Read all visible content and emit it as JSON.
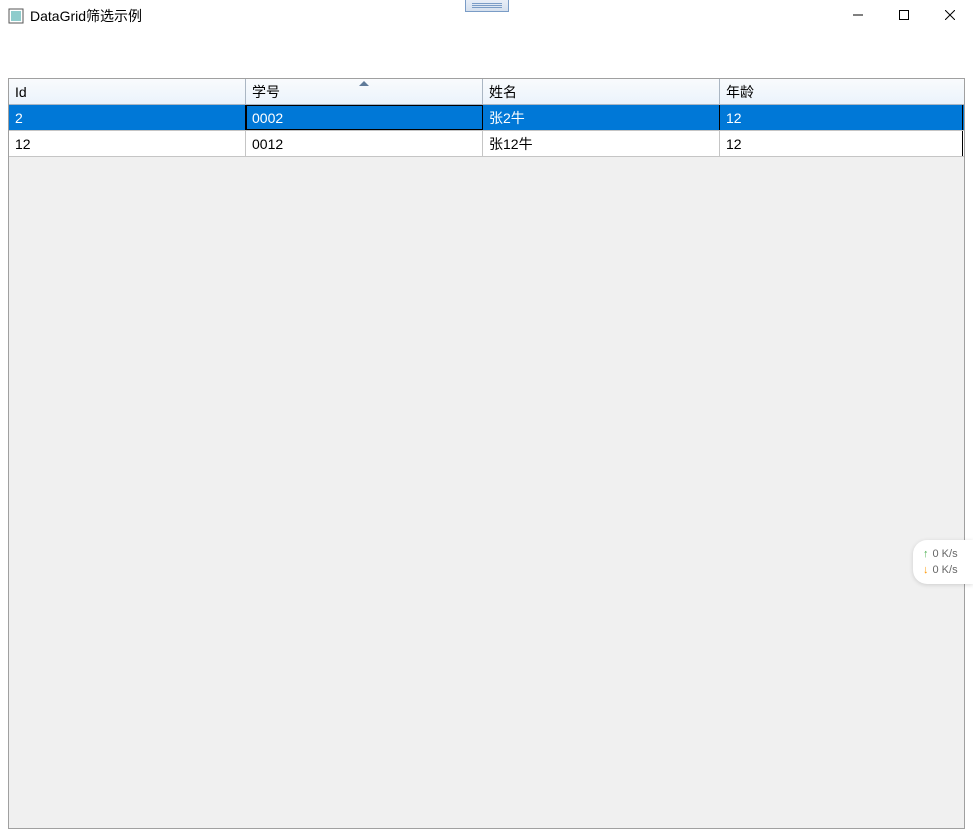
{
  "window": {
    "title": "DataGrid筛选示例"
  },
  "grid": {
    "columns": [
      {
        "header": "Id",
        "sorted": false
      },
      {
        "header": "学号",
        "sorted": true
      },
      {
        "header": "姓名",
        "sorted": false
      },
      {
        "header": "年龄",
        "sorted": false
      }
    ],
    "rows": [
      {
        "selected": true,
        "cells": [
          "2",
          "0002",
          "张2牛",
          "12"
        ]
      },
      {
        "selected": false,
        "cells": [
          "12",
          "0012",
          "张12牛",
          "12"
        ]
      }
    ]
  },
  "network": {
    "up": "0  K/s",
    "down": "0  K/s"
  }
}
